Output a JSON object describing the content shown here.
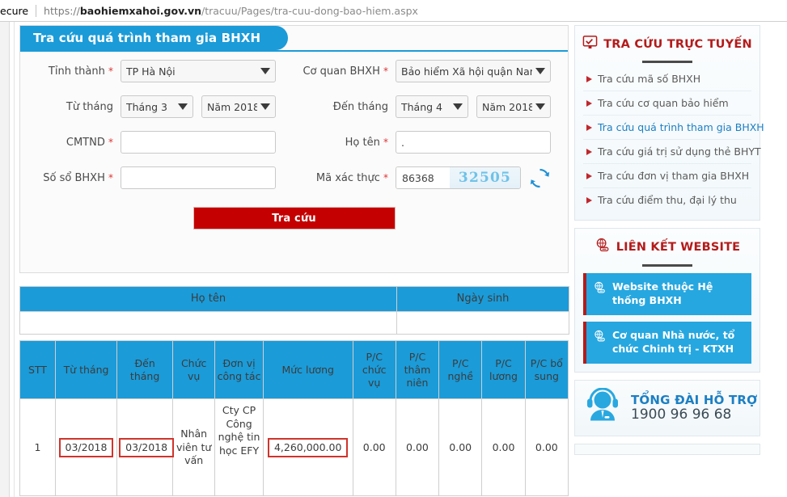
{
  "browser": {
    "secure_label": "ecure",
    "url_scheme": "https://",
    "url_host": "baohiemxahoi.gov.vn",
    "url_path": "/tracuu/Pages/tra-cuu-dong-bao-hiem.aspx"
  },
  "form": {
    "tab_title": "Tra cứu quá trình tham gia BHXH",
    "fields": {
      "province_label": "Tỉnh thành",
      "province_value": "TP Hà Nội",
      "agency_label": "Cơ quan BHXH",
      "agency_value": "Bảo hiểm Xã hội quận Nam Từ",
      "from_month_label": "Từ tháng",
      "from_month_value": "Tháng 3",
      "from_year_value": "Năm 2018",
      "to_month_label": "Đến tháng",
      "to_month_value": "Tháng 4",
      "to_year_value": "Năm 2018",
      "id_label": "CMTND",
      "id_value": "",
      "name_label": "Họ tên",
      "name_value": ".",
      "bhxh_label": "Số sổ BHXH",
      "bhxh_value": "",
      "captcha_label": "Mã xác thực",
      "captcha_value": "86368",
      "captcha_image_text": "32505",
      "refresh_icon": "refresh-icon"
    },
    "required_mark": "*",
    "submit_label": "Tra cứu"
  },
  "top_table": {
    "headers": [
      "Họ tên",
      "Ngày sinh"
    ],
    "row": [
      "",
      ""
    ]
  },
  "result_table": {
    "headers": [
      "STT",
      "Từ tháng",
      "Đến tháng",
      "Chức vụ",
      "Đơn vị công tác",
      "Mức lương",
      "P/C chức vụ",
      "P/C thâm niên",
      "P/C nghề",
      "P/C lương",
      "P/C bổ sung"
    ],
    "rows": [
      {
        "stt": "1",
        "from_month": "03/2018",
        "to_month": "03/2018",
        "position": "Nhân viên tư vấn",
        "company": "Cty CP Công nghệ tin học EFY",
        "salary": "4,260,000.00",
        "pc_chucvu": "0.00",
        "pc_thamnien": "0.00",
        "pc_nghe": "0.00",
        "pc_luong": "0.00",
        "pc_bosung": "0.00"
      }
    ]
  },
  "sidebar": {
    "lookup_panel": {
      "title": "TRA CỨU TRỰC TUYẾN",
      "icon": "monitor-check-icon",
      "items": [
        {
          "label": "Tra cứu mã số BHXH",
          "active": false
        },
        {
          "label": "Tra cứu cơ quan bảo hiểm",
          "active": false
        },
        {
          "label": "Tra cứu quá trình tham gia BHXH",
          "active": true
        },
        {
          "label": "Tra cứu giá trị sử dụng thẻ BHYT",
          "active": false
        },
        {
          "label": "Tra cứu đơn vị tham gia BHXH",
          "active": false
        },
        {
          "label": "Tra cứu điểm thu, đại lý thu",
          "active": false
        }
      ]
    },
    "links_panel": {
      "title": "LIÊN KẾT WEBSITE",
      "icon": "globe-link-icon",
      "buttons": [
        "Website thuộc Hệ thống BHXH",
        "Cơ quan Nhà nước, tổ chức Chinh trị - KTXH"
      ]
    },
    "hotline": {
      "icon": "headset-operator-icon",
      "title": "TỔNG ĐÀI HỖ TRỢ",
      "number": "1900 96 96 68"
    }
  },
  "colors": {
    "blue": "#1b9bd8",
    "red": "#c40000",
    "dark_red": "#b41b1b",
    "highlight_border": "#d0342c"
  }
}
